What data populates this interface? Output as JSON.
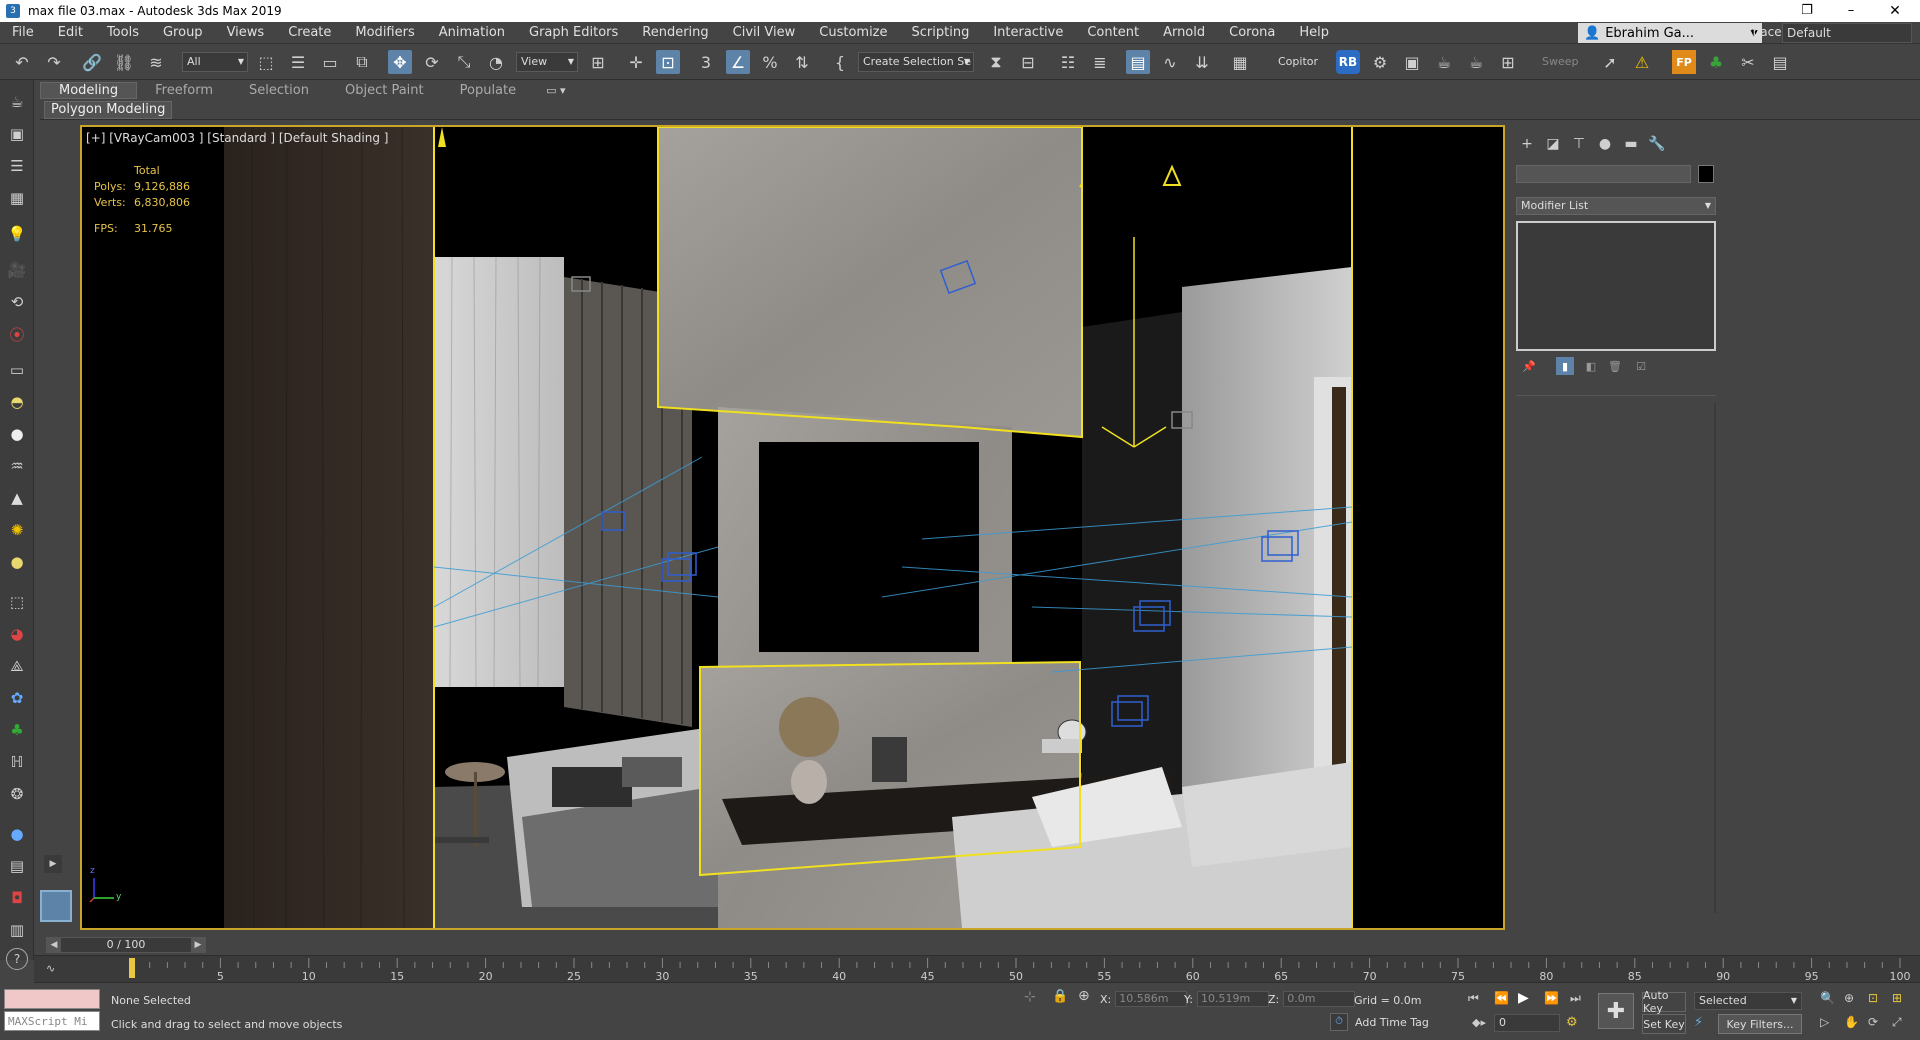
{
  "window": {
    "title": "max file 03.max - Autodesk 3ds Max 2019",
    "app_icon": "3ds-max-icon"
  },
  "menu": [
    "File",
    "Edit",
    "Tools",
    "Group",
    "Views",
    "Create",
    "Modifiers",
    "Animation",
    "Graph Editors",
    "Rendering",
    "Civil View",
    "Customize",
    "Scripting",
    "Interactive",
    "Content",
    "Arnold",
    "Corona",
    "Help"
  ],
  "user": {
    "name": "Ebrahim Ga..."
  },
  "workspace": {
    "label": "Workspaces:",
    "value": "Default"
  },
  "toolbar": {
    "filter": "All",
    "view": "View",
    "selection_set": "Create Selection Se",
    "copitor": "Copitor",
    "sweep": "Sweep",
    "rb": "RB",
    "fp": "FP",
    "snap_3": "3"
  },
  "ribbon": {
    "tabs": [
      "Modeling",
      "Freeform",
      "Selection",
      "Object Paint",
      "Populate"
    ],
    "active": "Modeling",
    "sub": "Polygon Modeling"
  },
  "viewport": {
    "label": "[+] [VRayCam003 ] [Standard ] [Default Shading ]",
    "stats": {
      "header": "Total",
      "polys_label": "Polys:",
      "polys": "9,126,886",
      "verts_label": "Verts:",
      "verts": "6,830,806",
      "fps_label": "FPS:",
      "fps": "31.765"
    },
    "axis_x": "x",
    "axis_y": "y",
    "axis_z": "z"
  },
  "command_panel": {
    "modifier_list": "Modifier List"
  },
  "timeline": {
    "position": "0 / 100",
    "ticks": [
      "5",
      "10",
      "15",
      "20",
      "25",
      "30",
      "35",
      "40",
      "45",
      "50",
      "55",
      "60",
      "65",
      "70",
      "75",
      "80",
      "85",
      "90",
      "95",
      "100"
    ]
  },
  "status": {
    "maxscript": "MAXScript Mi",
    "selection": "None Selected",
    "prompt": "Click and drag to select and move objects",
    "x_label": "X:",
    "x": "10.586m",
    "y_label": "Y:",
    "y": "10.519m",
    "z_label": "Z:",
    "z": "0.0m",
    "grid": "Grid = 0.0m",
    "add_time_tag": "Add Time Tag",
    "auto_key": "Auto Key",
    "selected": "Selected",
    "set_key": "Set Key",
    "key_filters": "Key Filters...",
    "frame": "0"
  },
  "colors": {
    "viewport_border": "#c9a52a",
    "stats_text": "#e6c44a",
    "selection_yellow": "#f0e020",
    "light_blue": "#3a7bd5",
    "active_button": "#5d83a8"
  }
}
